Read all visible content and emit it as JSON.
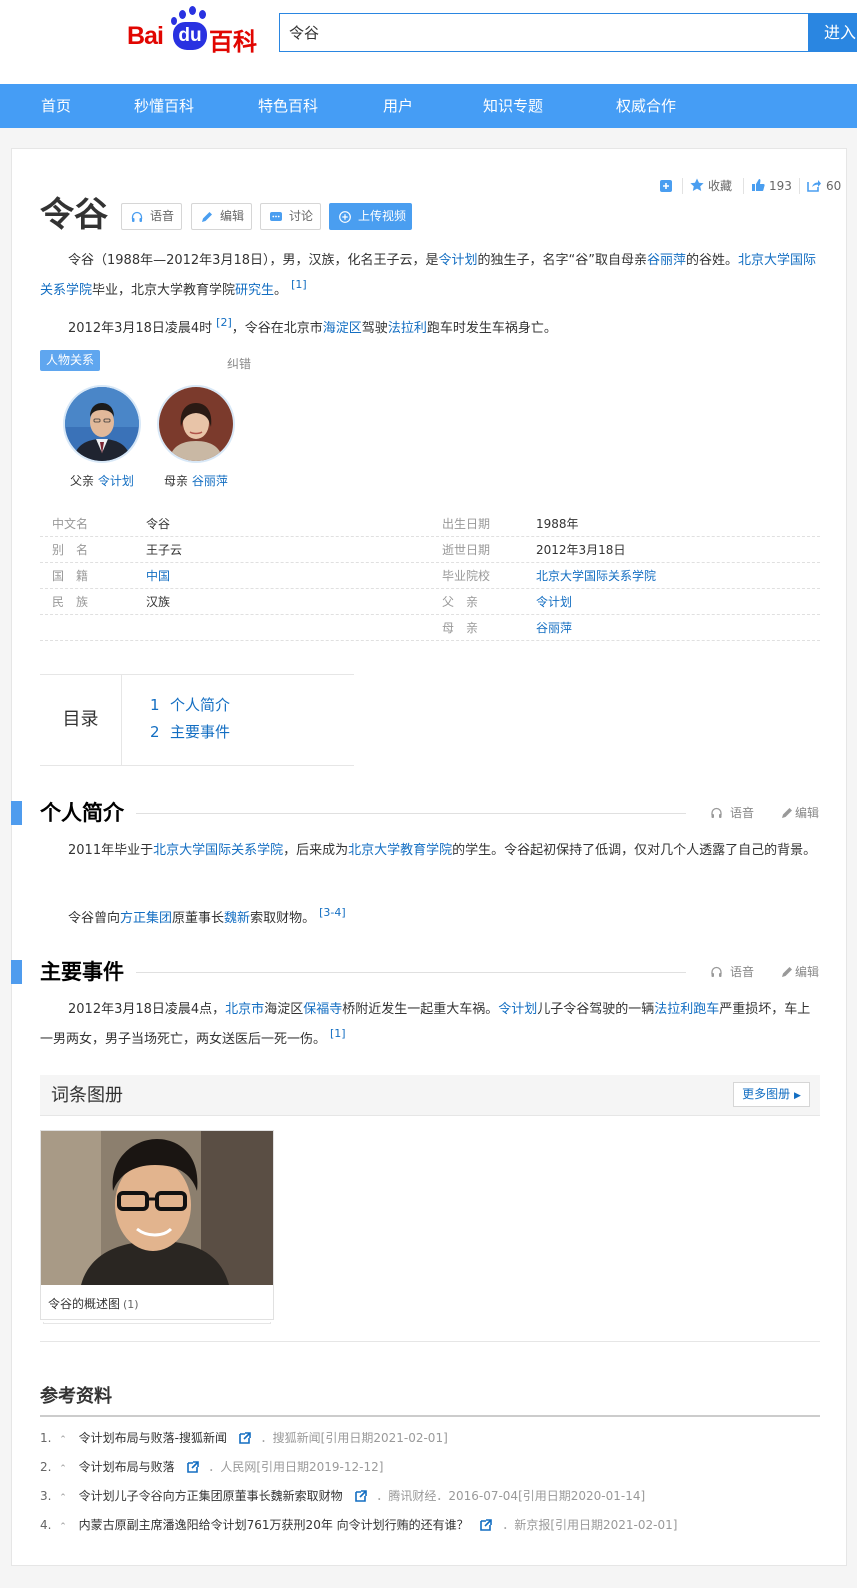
{
  "header": {
    "logo": {
      "bai": "Bai",
      "du": "du",
      "baike": "百科"
    },
    "search": {
      "value": "令谷",
      "button": "进入"
    },
    "nav": [
      "首页",
      "秒懂百科",
      "特色百科",
      "用户",
      "知识专题",
      "权威合作"
    ]
  },
  "tools": {
    "collect": "收藏",
    "likes": "193",
    "shares": "60"
  },
  "entry": {
    "title": "令谷",
    "buttons": {
      "voice": "语音",
      "edit": "编辑",
      "discuss": "讨论",
      "upload": "上传视频"
    }
  },
  "summary": {
    "p1": {
      "t1": "令谷（1988年—2012年3月18日），男，汉族，化名王子云，是",
      "l1": "令计划",
      "t2": "的独生子，名字“谷”取自母亲",
      "l2": "谷丽萍",
      "t3": "的谷姓。",
      "l3": "北京大学国际关系学院",
      "t4": "毕业，北京大学教育学院",
      "l4": "研究生",
      "t5": "。",
      "ref": "[1]"
    },
    "p2": {
      "t1": "2012年3月18日凌晨4时",
      "ref": "[2]",
      "t2": "，令谷在北京市",
      "l1": "海淀区",
      "t3": "驾驶",
      "l2": "法拉利",
      "t4": "跑车时发生车祸身亡。"
    }
  },
  "relations": {
    "tag": "人物关系",
    "correct": "纠错",
    "people": [
      {
        "role": "父亲",
        "name": "令计划"
      },
      {
        "role": "母亲",
        "name": "谷丽萍"
      }
    ]
  },
  "basic_info": [
    {
      "left_name": "中文名",
      "left_value": "令谷",
      "left_link": false,
      "right_name": "出生日期",
      "right_value": "1988年",
      "right_link": false
    },
    {
      "left_name": "别　名",
      "left_value": "王子云",
      "left_link": false,
      "right_name": "逝世日期",
      "right_value": "2012年3月18日",
      "right_link": false
    },
    {
      "left_name": "国　籍",
      "left_value": "中国",
      "left_link": true,
      "right_name": "毕业院校",
      "right_value": "北京大学国际关系学院",
      "right_link": true
    },
    {
      "left_name": "民　族",
      "left_value": "汉族",
      "left_link": false,
      "right_name": "父　亲",
      "right_value": "令计划",
      "right_link": true
    },
    {
      "left_name": "",
      "left_value": "",
      "left_link": false,
      "right_name": "母　亲",
      "right_value": "谷丽萍",
      "right_link": true
    }
  ],
  "toc": {
    "title": "目录",
    "items": [
      {
        "num": "1",
        "label": "个人简介"
      },
      {
        "num": "2",
        "label": "主要事件"
      }
    ]
  },
  "sections": {
    "bio": {
      "title": "个人简介",
      "voice": "语音",
      "edit": "编辑",
      "p1": {
        "t1": "2011年毕业于",
        "l1": "北京大学国际关系学院",
        "t2": "，后来成为",
        "l2": "北京大学教育学院",
        "t3": "的学生。令谷起初保持了低调，仅对几个人透露了自己的背景。"
      },
      "p2": {
        "t1": "令谷曾向",
        "l1": "方正集团",
        "t2": "原董事长",
        "l2": "魏新",
        "t3": "索取财物。",
        "ref": "[3-4]"
      }
    },
    "events": {
      "title": "主要事件",
      "voice": "语音",
      "edit": "编辑",
      "p1": {
        "t1": "2012年3月18日凌晨4点，",
        "l1": "北京市",
        "t2": "海淀区",
        "l2": "保福寺",
        "t3": "桥附近发生一起重大车祸。",
        "l3": "令计划",
        "t4": "儿子令谷驾驶的一辆",
        "l4": "法拉利跑车",
        "t5": "严重损坏，车上一男两女，男子当场死亡，两女送医后一死一伤。",
        "ref": "[1]"
      }
    }
  },
  "album": {
    "title": "词条图册",
    "more": "更多图册",
    "caption": "令谷的概述图",
    "count": "(1)"
  },
  "references": {
    "title": "参考资料",
    "items": [
      {
        "num": "1.",
        "title": "令计划布局与败落-搜狐新闻",
        "source": "．搜狐新闻[引用日期2021-02-01]"
      },
      {
        "num": "2.",
        "title": "令计划布局与败落",
        "source": "．人民网[引用日期2019-12-12]"
      },
      {
        "num": "3.",
        "title": "令计划儿子令谷向方正集团原董事长魏新索取财物",
        "source": "．腾讯财经．2016-07-04[引用日期2020-01-14]"
      },
      {
        "num": "4.",
        "title": "内蒙古原副主席潘逸阳给令计划761万获刑20年 向令计划行贿的还有谁？",
        "source": "．新京报[引用日期2021-02-01]"
      }
    ]
  }
}
